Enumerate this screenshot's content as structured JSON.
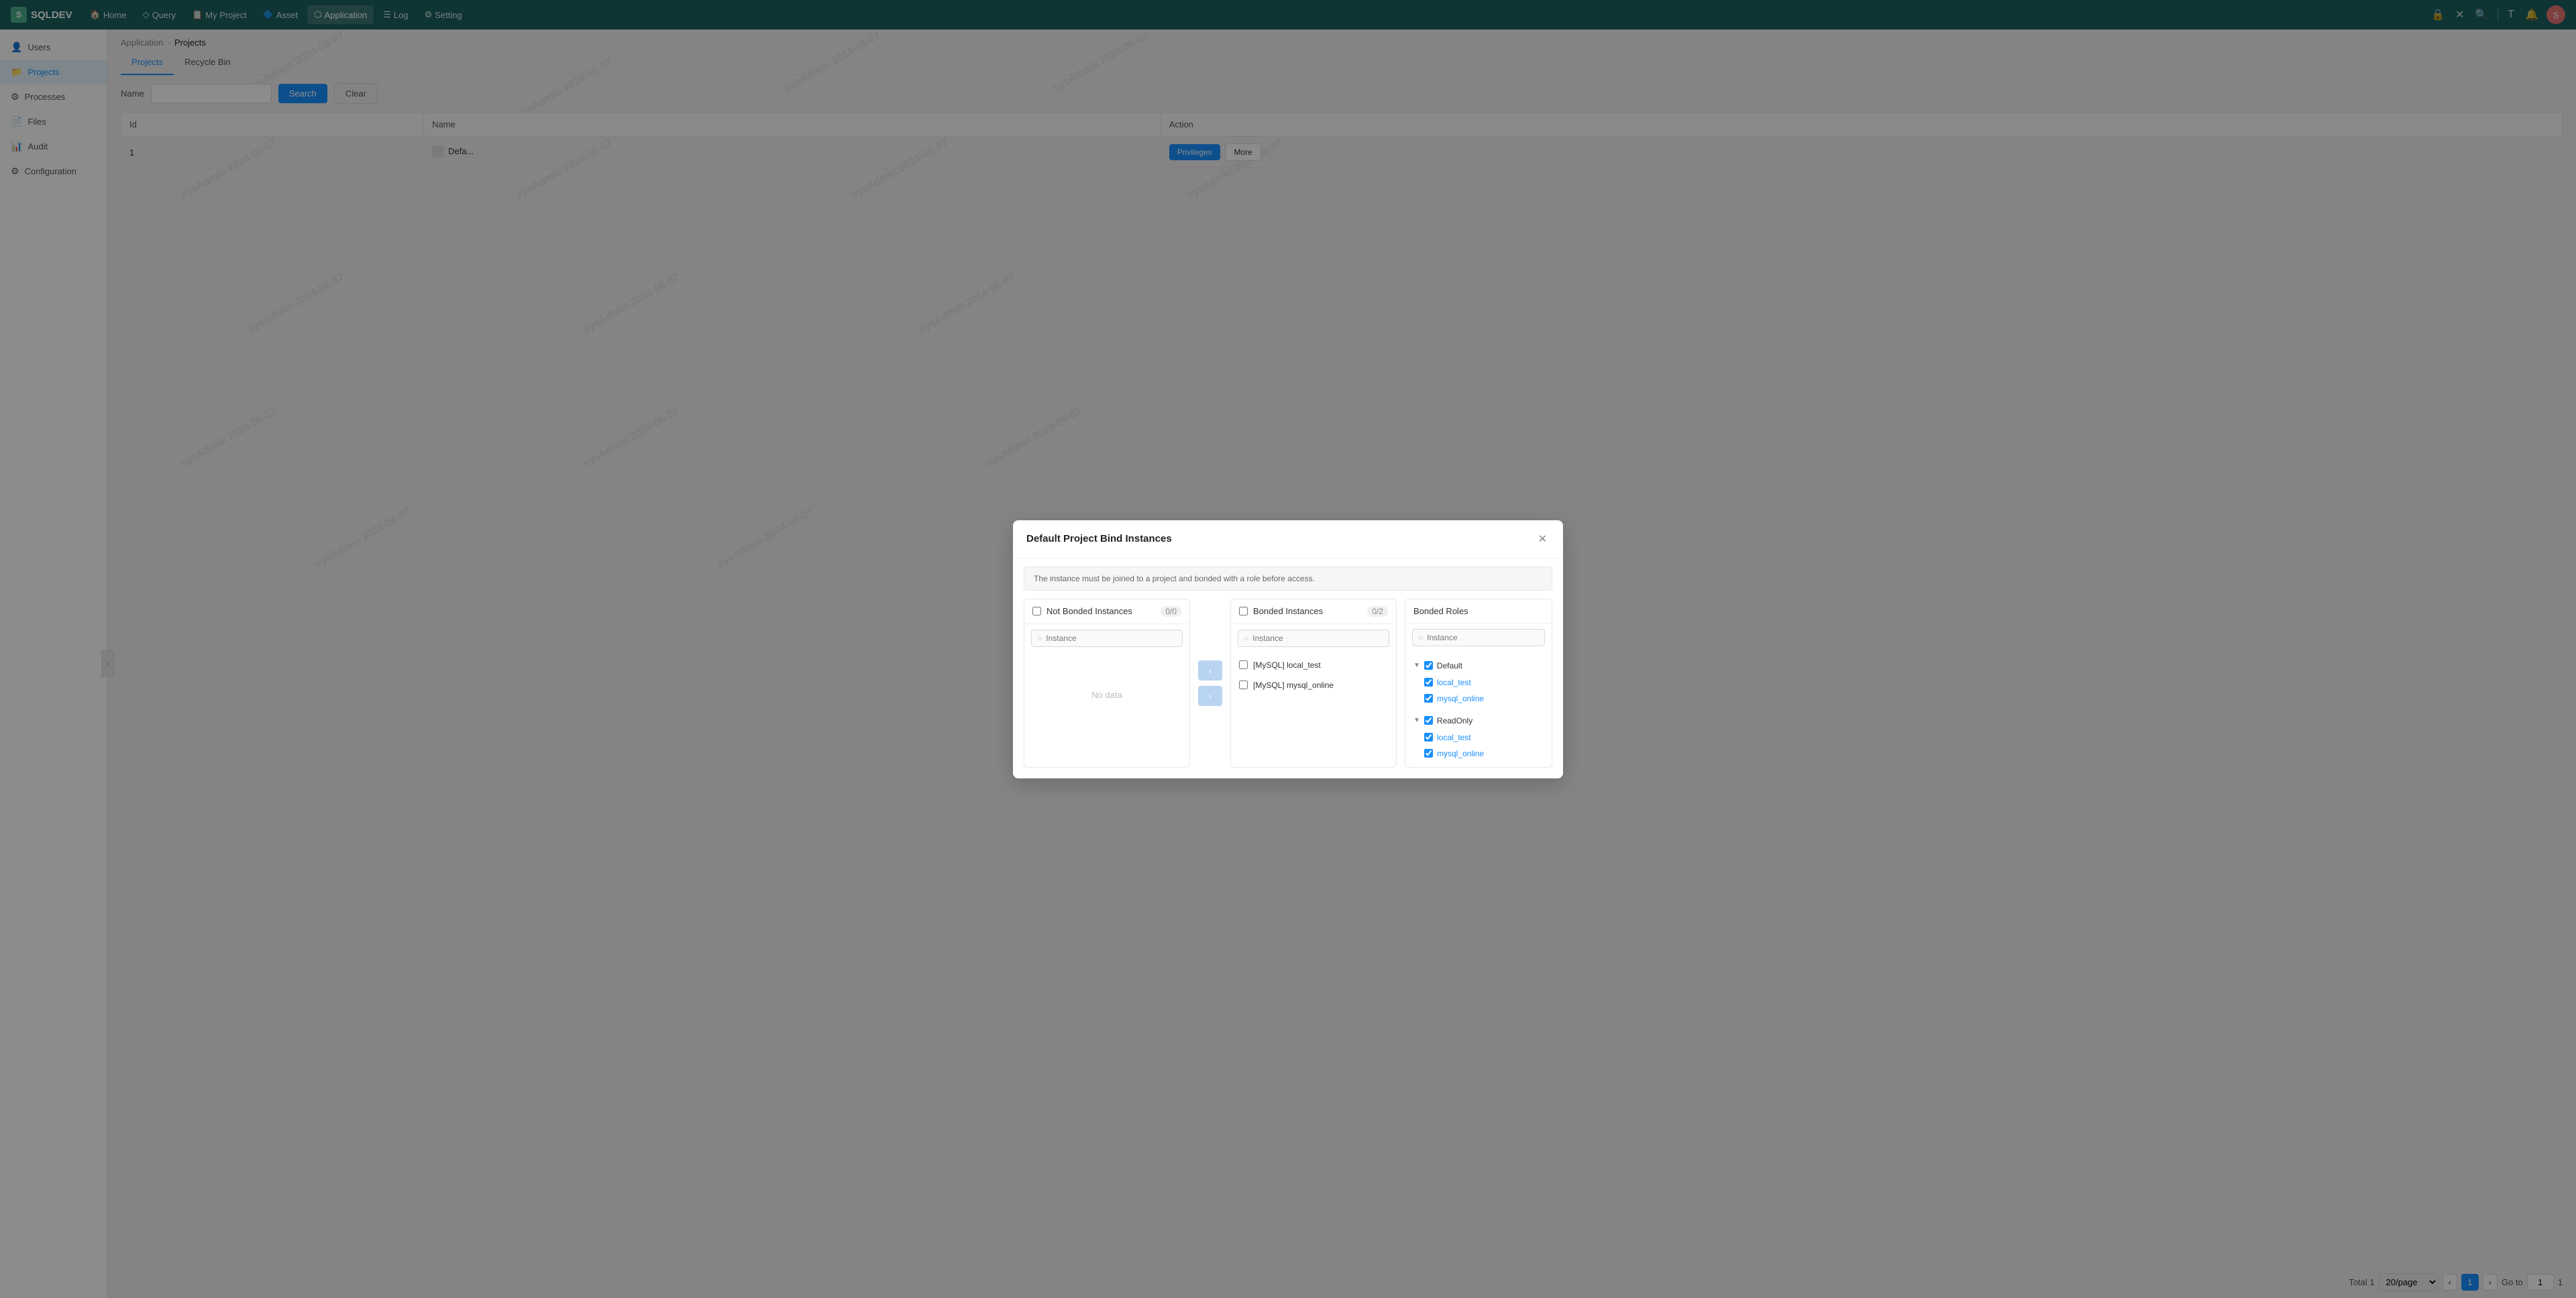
{
  "app": {
    "logo": "SQLDEV",
    "logo_icon": "S"
  },
  "topnav": {
    "items": [
      {
        "label": "Home",
        "icon": "🏠",
        "active": false
      },
      {
        "label": "Query",
        "icon": "◇",
        "active": false
      },
      {
        "label": "My Project",
        "icon": "📋",
        "active": false
      },
      {
        "label": "Asset",
        "icon": "🔷",
        "active": false
      },
      {
        "label": "Application",
        "icon": "⬡",
        "active": true
      },
      {
        "label": "Log",
        "icon": "☰",
        "active": false
      },
      {
        "label": "Setting",
        "icon": "⚙",
        "active": false
      }
    ],
    "right_icons": [
      "🔒",
      "✕",
      "🔍",
      "|",
      "T",
      "🔔"
    ],
    "avatar_label": "S"
  },
  "sidebar": {
    "items": [
      {
        "label": "Users",
        "icon": "👤",
        "active": false
      },
      {
        "label": "Projects",
        "icon": "📁",
        "active": true
      },
      {
        "label": "Processes",
        "icon": "⚙",
        "active": false
      },
      {
        "label": "Files",
        "icon": "📄",
        "active": false
      },
      {
        "label": "Audit",
        "icon": "📊",
        "active": false
      },
      {
        "label": "Configuration",
        "icon": "⚙",
        "active": false
      }
    ]
  },
  "breadcrumb": {
    "parent": "Application",
    "current": "Projects"
  },
  "tabs": [
    {
      "label": "Projects",
      "active": true
    },
    {
      "label": "Recycle Bin",
      "active": false
    }
  ],
  "toolbar": {
    "name_label": "Name",
    "search_btn": "Search",
    "clear_btn": "Clear"
  },
  "table": {
    "columns": [
      "Id",
      "Name",
      "Action"
    ],
    "rows": [
      {
        "id": "1",
        "name": "Defa...",
        "has_icon": true,
        "action_privileges": "Privileges",
        "action_more": "More"
      }
    ],
    "total_label": "Total 1",
    "per_page": "20/page",
    "page_current": "1",
    "goto_label": "Go to",
    "goto_suffix": "1"
  },
  "modal": {
    "title": "Default Project Bind Instances",
    "notice": "The instance must be joined to a project and bonded with a role before access.",
    "close_icon": "✕",
    "not_bonded": {
      "label": "Not Bonded Instances",
      "count": "0/0",
      "search_placeholder": "Instance",
      "empty_text": "No data"
    },
    "bonded": {
      "label": "Bonded Instances",
      "count": "0/2",
      "search_placeholder": "Instance",
      "items": [
        {
          "label": "[MySQL] local_test",
          "checked": false
        },
        {
          "label": "[MySQL] mysql_online",
          "checked": false
        }
      ]
    },
    "transfer_prev": "‹",
    "transfer_next": "›",
    "roles": {
      "title": "Bonded Roles",
      "search_placeholder": "Instance",
      "groups": [
        {
          "label": "Default",
          "checked": true,
          "expanded": true,
          "children": [
            {
              "label": "local_test",
              "checked": true
            },
            {
              "label": "mysql_online",
              "checked": true
            }
          ]
        },
        {
          "label": "ReadOnly",
          "checked": true,
          "expanded": true,
          "children": [
            {
              "label": "local_test",
              "checked": true
            },
            {
              "label": "mysql_online",
              "checked": true
            }
          ]
        }
      ]
    }
  },
  "watermark": {
    "text": "sysAdmin 2024-06-07"
  }
}
